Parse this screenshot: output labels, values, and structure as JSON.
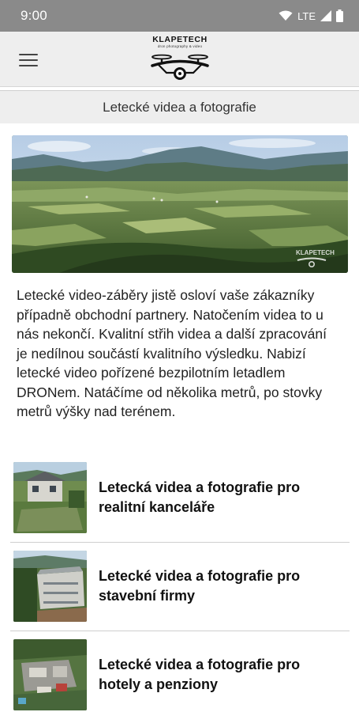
{
  "status_bar": {
    "time": "9:00",
    "network": "LTE"
  },
  "app_bar": {
    "menu_icon": "hamburger-menu-icon",
    "logo": {
      "name": "KLAPETECH",
      "tagline": "dron photography & video"
    }
  },
  "page": {
    "section_title": "Letecké videa a fotografie"
  },
  "hero": {
    "watermark": "KLAPETECH"
  },
  "intro": {
    "text": "Letecké video-záběry jistě osloví vaše zákazníky případně obchodní partnery. Natočením videa to u nás nekončí. Kvalitní střih videa a další zpracování je nedílnou součástí kvalitního výsledku. Nabizí letecké video pořízené bezpilotním letadlem DRONem. Natáčíme od několika metrů, po stovky metrů výšky nad terénem."
  },
  "articles": [
    {
      "title": "Letecká videa a fotografie pro realitní kanceláře"
    },
    {
      "title": "Letecké videa a fotografie pro stavební firmy"
    },
    {
      "title": "Letecké videa a fotografie pro hotely a penziony"
    }
  ],
  "colors": {
    "status_bar": "#8a8a8a",
    "app_bar": "#eeeeee",
    "divider": "#cfcfcf"
  }
}
